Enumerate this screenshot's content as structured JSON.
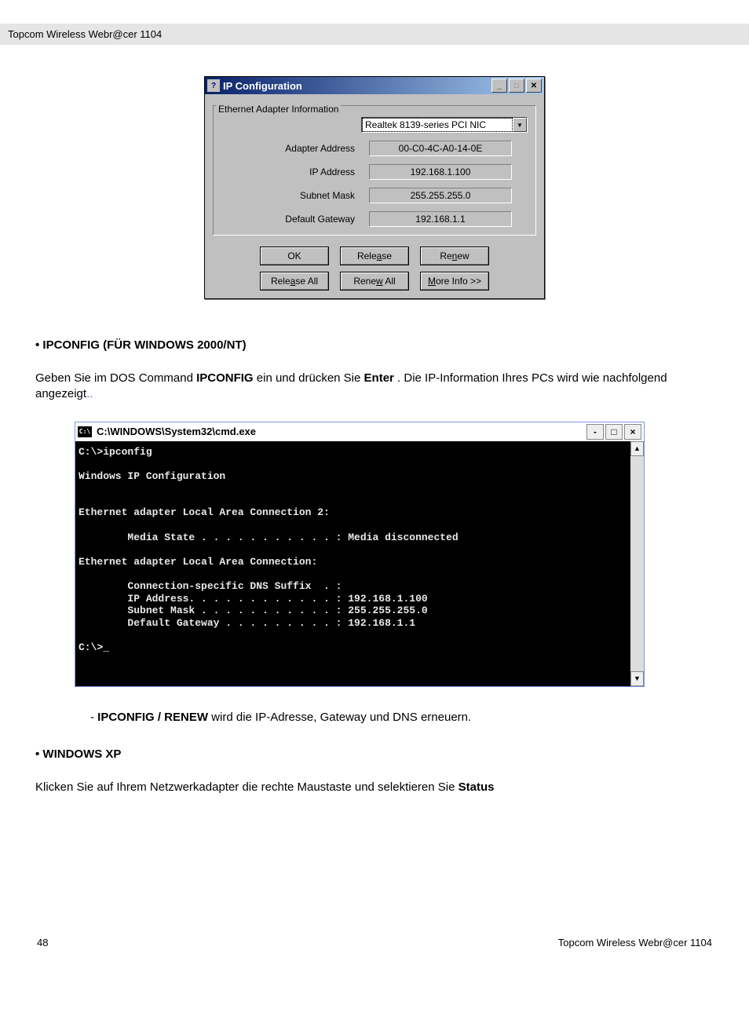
{
  "header": {
    "text": "Topcom Wireless Webr@cer 1104"
  },
  "ipconfig_dialog": {
    "title": "IP Configuration",
    "fieldset_label": "Ethernet Adapter Information",
    "dropdown_value": "Realtek 8139-series PCI NIC",
    "rows": {
      "adapter_address": {
        "label": "Adapter Address",
        "value": "00-C0-4C-A0-14-0E"
      },
      "ip_address": {
        "label": "IP Address",
        "value": "192.168.1.100"
      },
      "subnet_mask": {
        "label": "Subnet Mask",
        "value": "255.255.255.0"
      },
      "default_gateway": {
        "label": "Default Gateway",
        "value": "192.168.1.1"
      }
    },
    "buttons": {
      "ok": "OK",
      "release": "Release",
      "renew": "Renew",
      "release_all": "Release All",
      "renew_all": "Renew All",
      "more_info": "More Info >>"
    }
  },
  "section1": {
    "heading": "• IPCONFIG (FÜR WINDOWS 2000/NT)",
    "text_pre": "Geben Sie im DOS Command ",
    "text_bold1": "IPCONFIG",
    "text_mid": " ein und drücken Sie ",
    "text_bold2": "Enter",
    "text_post": ". Die IP-Information Ihres PCs wird wie nachfolgend angezeigt",
    "trailing_dots": ".."
  },
  "cmd_window": {
    "title_prefix": "C:\\WINDOWS\\System32\\cmd.exe",
    "icon_label": "C:\\",
    "content": "C:\\>ipconfig\n\nWindows IP Configuration\n\n\nEthernet adapter Local Area Connection 2:\n\n        Media State . . . . . . . . . . . : Media disconnected\n\nEthernet adapter Local Area Connection:\n\n        Connection-specific DNS Suffix  . :\n        IP Address. . . . . . . . . . . . : 192.168.1.100\n        Subnet Mask . . . . . . . . . . . : 255.255.255.0\n        Default Gateway . . . . . . . . . : 192.168.1.1\n\nC:\\>_"
  },
  "renew_note": {
    "dash": "- ",
    "bold": "IPCONFIG / RENEW",
    "rest": " wird die IP-Adresse, Gateway und DNS erneuern."
  },
  "section2": {
    "heading": "• WINDOWS XP",
    "text_pre": "Klicken Sie auf Ihrem Netzwerkadapter die rechte Maustaste und selektieren Sie ",
    "text_bold": "Status"
  },
  "footer": {
    "page": "48",
    "product": "Topcom Wireless Webr@cer 1104"
  }
}
